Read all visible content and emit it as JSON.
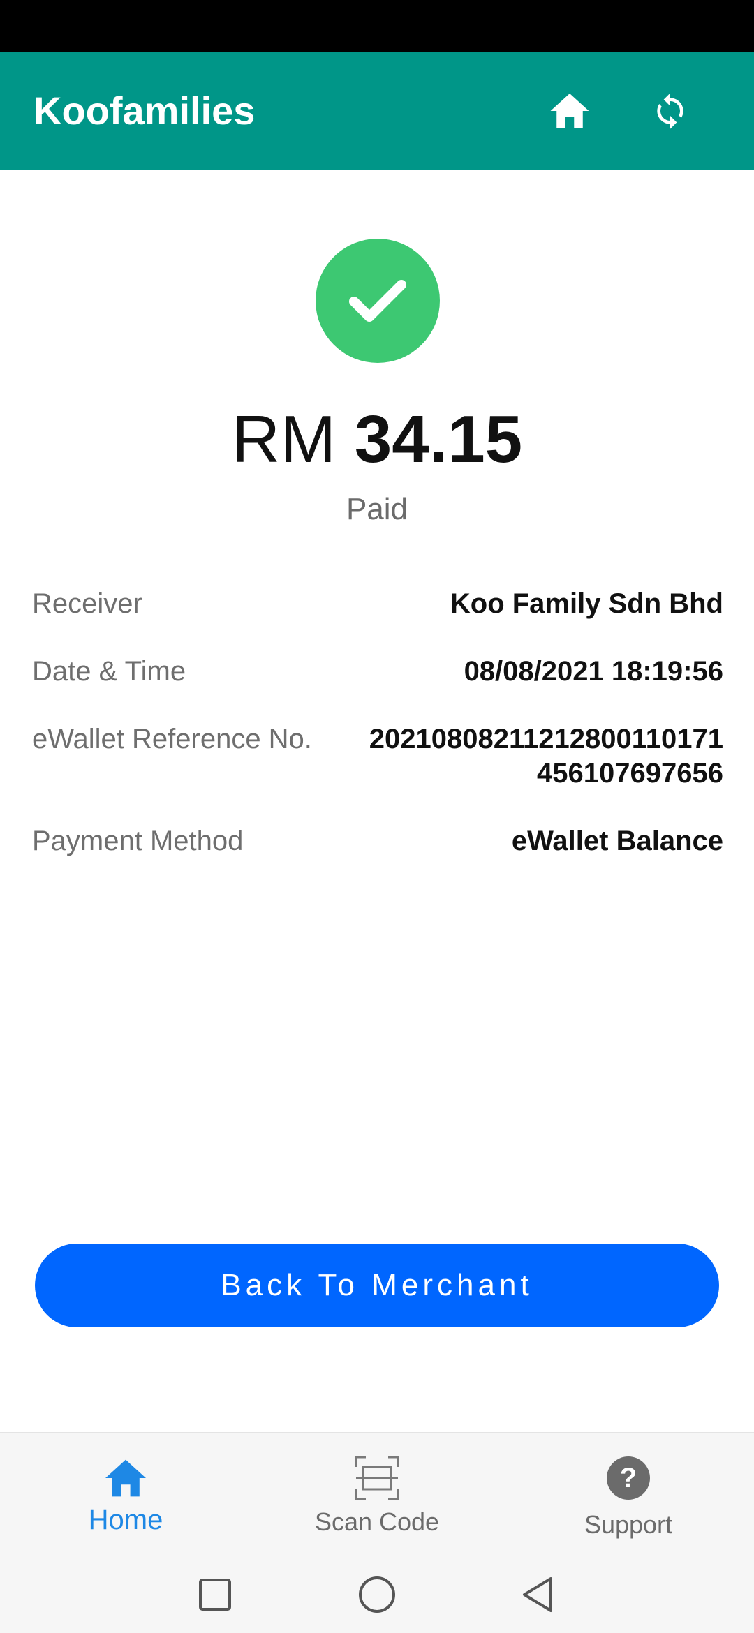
{
  "app_bar": {
    "title": "Koofamilies",
    "home_icon": "home-icon",
    "refresh_icon": "refresh-icon",
    "background": "#009688"
  },
  "receipt": {
    "status_icon": "check-circle-icon",
    "currency": "RM",
    "amount": "34.15",
    "status": "Paid",
    "details": [
      {
        "label": "Receiver",
        "value": "Koo Family Sdn Bhd"
      },
      {
        "label": "Date & Time",
        "value": "08/08/2021 18:19:56"
      },
      {
        "label": "eWallet Reference No.",
        "value": "20210808211212800110171456107697656"
      },
      {
        "label": "Payment Method",
        "value": "eWallet Balance"
      }
    ]
  },
  "actions": {
    "back_label": "Back To Merchant",
    "accent": "#0066ff"
  },
  "bottom_nav": {
    "items": [
      {
        "label": "Home",
        "icon": "home-icon",
        "active": true
      },
      {
        "label": "Scan Code",
        "icon": "scan-code-icon",
        "active": false
      },
      {
        "label": "Support",
        "icon": "help-icon",
        "active": false
      }
    ],
    "active_color": "#1e88e5"
  },
  "system_nav": {
    "recent_icon": "square-icon",
    "home_icon": "circle-icon",
    "back_icon": "triangle-back-icon"
  }
}
